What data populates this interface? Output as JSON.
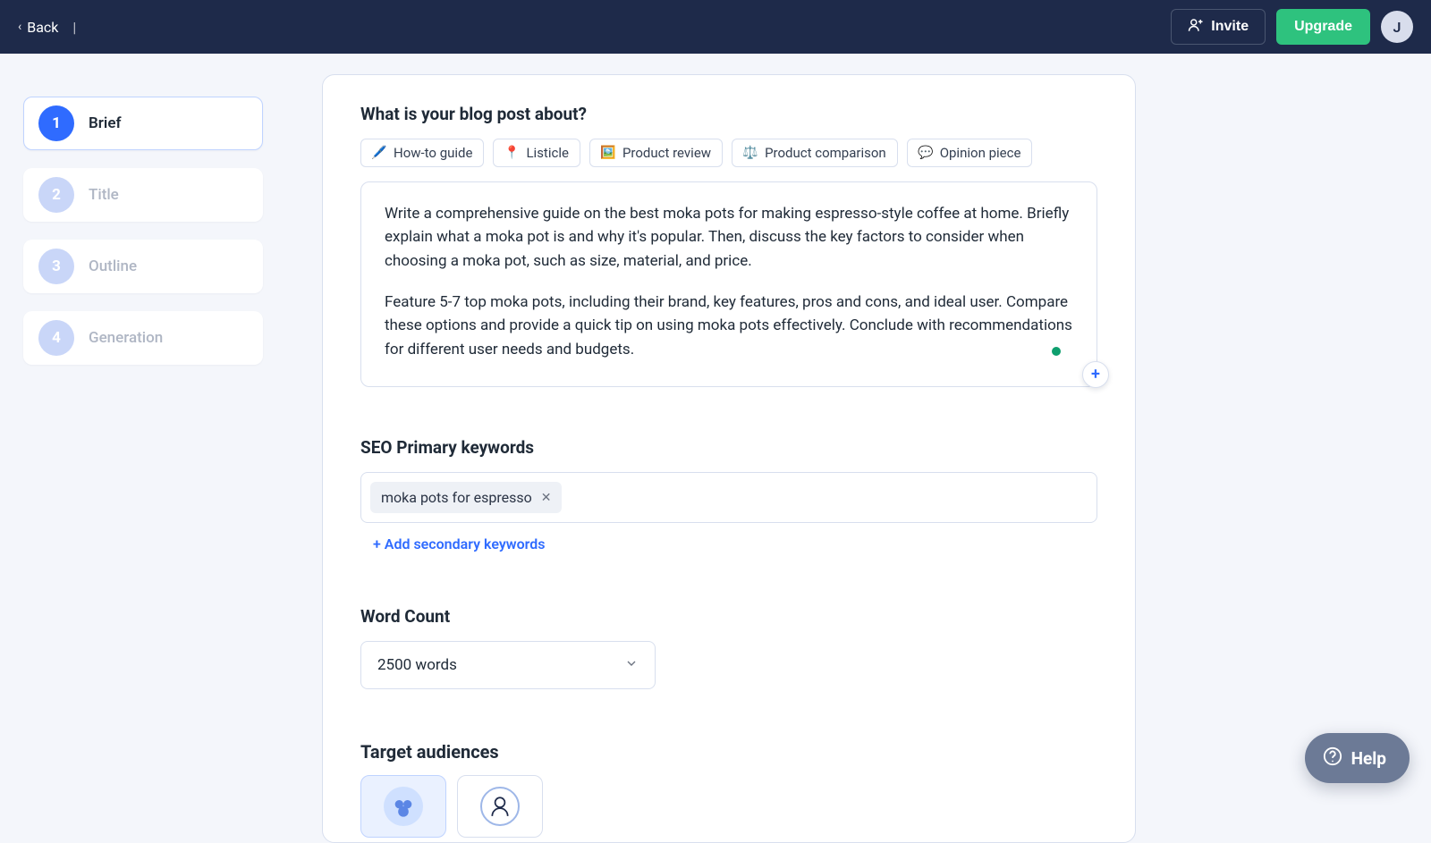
{
  "topbar": {
    "back_label": "Back",
    "invite_label": "Invite",
    "upgrade_label": "Upgrade",
    "avatar_initial": "J"
  },
  "sidebar": {
    "steps": [
      {
        "num": "1",
        "label": "Brief",
        "active": true
      },
      {
        "num": "2",
        "label": "Title"
      },
      {
        "num": "3",
        "label": "Outline"
      },
      {
        "num": "4",
        "label": "Generation"
      }
    ]
  },
  "main": {
    "about_heading": "What is your blog post about?",
    "chips": [
      {
        "icon": "wand-icon",
        "label": "How-to guide"
      },
      {
        "icon": "pin-icon",
        "label": "Listicle"
      },
      {
        "icon": "frame-icon",
        "label": "Product review"
      },
      {
        "icon": "scales-icon",
        "label": "Product comparison"
      },
      {
        "icon": "chat-icon",
        "label": "Opinion piece"
      }
    ],
    "brief_para1": "Write a comprehensive guide on the best moka pots for making espresso-style coffee at home. Briefly explain what a moka pot is and why it's popular. Then, discuss the key factors to consider when choosing a moka pot, such as size, material, and price.",
    "brief_para2": "Feature 5-7 top moka pots, including their brand, key features, pros and cons, and ideal user. Compare these options and provide a quick tip on using moka pots effectively. Conclude with recommendations for different user needs and budgets.",
    "seo_heading": "SEO Primary keywords",
    "keywords": [
      {
        "text": "moka pots for espresso"
      }
    ],
    "add_secondary_label": "+ Add secondary keywords",
    "wordcount_heading": "Word Count",
    "wordcount_value": "2500 words",
    "audiences_heading": "Target audiences"
  },
  "help_label": "Help"
}
